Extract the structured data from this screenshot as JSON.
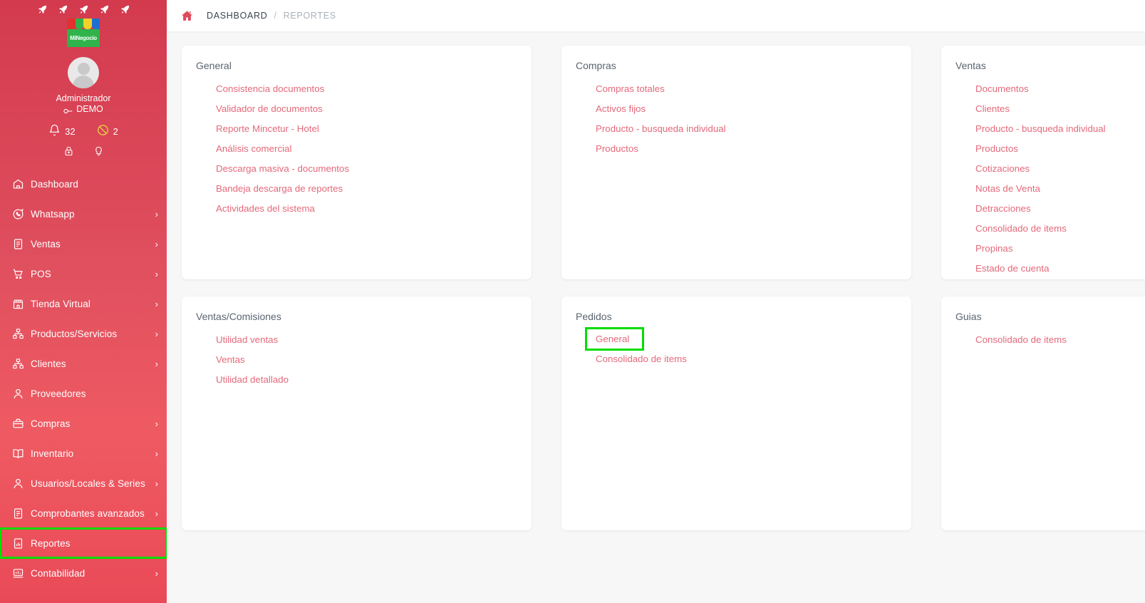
{
  "sidebar": {
    "rocket_count": 5,
    "rocket_icon": "rocket-icon",
    "logo_text": "MiNegocio",
    "user_name": "Administrador",
    "user_role": "DEMO",
    "notifications": {
      "icon": "bell-icon",
      "count": "32"
    },
    "blocked": {
      "icon": "no-entry-icon",
      "count": "2"
    },
    "quick_icons": [
      "lock-icon",
      "lightbulb-icon"
    ],
    "items": [
      {
        "label": "Dashboard",
        "icon": "home-store-icon",
        "chevron": false,
        "highlighted": false
      },
      {
        "label": "Whatsapp",
        "icon": "whatsapp-icon",
        "chevron": true,
        "highlighted": false
      },
      {
        "label": "Ventas",
        "icon": "document-icon",
        "chevron": true,
        "highlighted": false
      },
      {
        "label": "POS",
        "icon": "cart-icon",
        "chevron": true,
        "highlighted": false
      },
      {
        "label": "Tienda Virtual",
        "icon": "store-icon",
        "chevron": true,
        "highlighted": false
      },
      {
        "label": "Productos/Servicios",
        "icon": "products-icon",
        "chevron": true,
        "highlighted": false
      },
      {
        "label": "Clientes",
        "icon": "products-icon",
        "chevron": true,
        "highlighted": false
      },
      {
        "label": "Proveedores",
        "icon": "person-icon",
        "chevron": false,
        "highlighted": false
      },
      {
        "label": "Compras",
        "icon": "briefcase-icon",
        "chevron": true,
        "highlighted": false
      },
      {
        "label": "Inventario",
        "icon": "book-icon",
        "chevron": true,
        "highlighted": false
      },
      {
        "label": "Usuarios/Locales & Series",
        "icon": "person-icon",
        "chevron": true,
        "highlighted": false
      },
      {
        "label": "Comprobantes avanzados",
        "icon": "document-icon",
        "chevron": true,
        "highlighted": false
      },
      {
        "label": "Reportes",
        "icon": "chart-report-icon",
        "chevron": false,
        "highlighted": true
      },
      {
        "label": "Contabilidad",
        "icon": "accounting-icon",
        "chevron": true,
        "highlighted": false
      }
    ]
  },
  "topbar": {
    "home_icon": "home-icon",
    "breadcrumb": {
      "root": "DASHBOARD",
      "separator": "/",
      "current": "REPORTES"
    }
  },
  "cards": [
    {
      "title": "General",
      "links": [
        {
          "label": "Consistencia documentos",
          "highlighted": false
        },
        {
          "label": "Validador de documentos",
          "highlighted": false
        },
        {
          "label": "Reporte Mincetur - Hotel",
          "highlighted": false
        },
        {
          "label": "Análisis comercial",
          "highlighted": false
        },
        {
          "label": "Descarga masiva - documentos",
          "highlighted": false
        },
        {
          "label": "Bandeja descarga de reportes",
          "highlighted": false
        },
        {
          "label": "Actividades del sistema",
          "highlighted": false
        }
      ]
    },
    {
      "title": "Compras",
      "links": [
        {
          "label": "Compras totales",
          "highlighted": false
        },
        {
          "label": "Activos fijos",
          "highlighted": false
        },
        {
          "label": "Producto - busqueda individual",
          "highlighted": false
        },
        {
          "label": "Productos",
          "highlighted": false
        }
      ]
    },
    {
      "title": "Ventas",
      "links": [
        {
          "label": "Documentos",
          "highlighted": false
        },
        {
          "label": "Clientes",
          "highlighted": false
        },
        {
          "label": "Producto - busqueda individual",
          "highlighted": false
        },
        {
          "label": "Productos",
          "highlighted": false
        },
        {
          "label": "Cotizaciones",
          "highlighted": false
        },
        {
          "label": "Notas de Venta",
          "highlighted": false
        },
        {
          "label": "Detracciones",
          "highlighted": false
        },
        {
          "label": "Consolidado de items",
          "highlighted": false
        },
        {
          "label": "Propinas",
          "highlighted": false
        },
        {
          "label": "Estado de cuenta",
          "highlighted": false
        }
      ]
    },
    {
      "title": "Ventas/Comisiones",
      "links": [
        {
          "label": "Utilidad ventas",
          "highlighted": false
        },
        {
          "label": "Ventas",
          "highlighted": false
        },
        {
          "label": "Utilidad detallado",
          "highlighted": false
        }
      ]
    },
    {
      "title": "Pedidos",
      "links": [
        {
          "label": "General",
          "highlighted": true
        },
        {
          "label": "Consolidado de items",
          "highlighted": false
        }
      ]
    },
    {
      "title": "Guias",
      "links": [
        {
          "label": "Consolidado de items",
          "highlighted": false
        }
      ]
    }
  ],
  "colors": {
    "sidebar_top": "#d33a4e",
    "sidebar_mid": "#ef5a62",
    "link_red": "#e4697a",
    "highlight_green": "#00dd00",
    "page_bg": "#f7f7f8",
    "card_bg": "#ffffff",
    "breadcrumb_active": "#3b4450",
    "breadcrumb_inactive": "#aab0b8"
  }
}
